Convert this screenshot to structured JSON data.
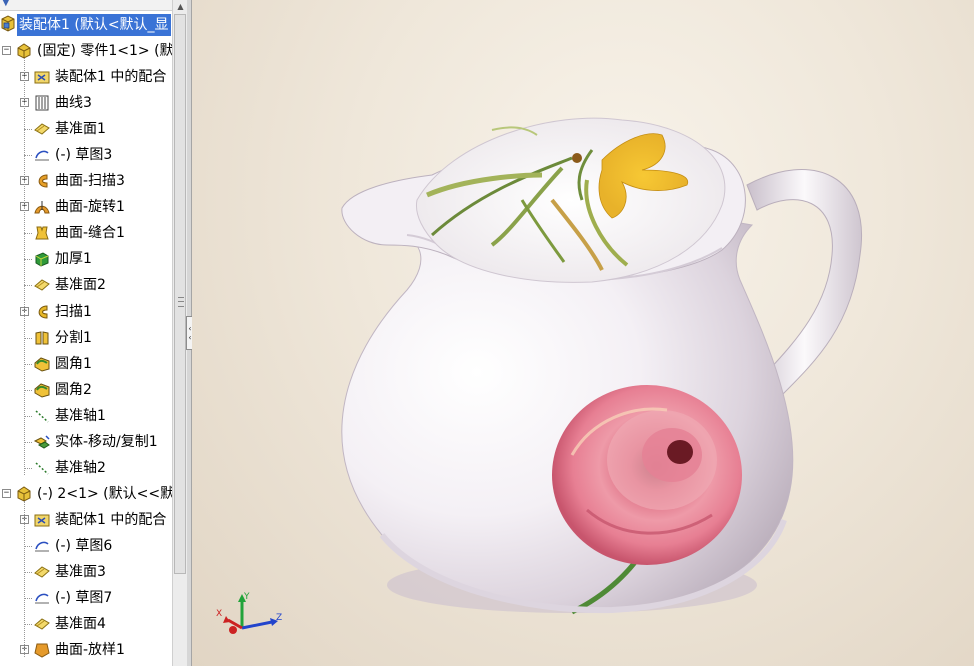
{
  "tree": {
    "root_label": "装配体1 (默认<默认_显",
    "rows": [
      {
        "label": "(固定) 零件1<1> (默",
        "icon": "part-icon",
        "level": 0,
        "expander": "−"
      },
      {
        "label": "装配体1 中的配合",
        "icon": "mates-folder-icon",
        "level": 1,
        "expander": "+"
      },
      {
        "label": "曲线3",
        "icon": "curve-icon",
        "level": 1,
        "expander": "+"
      },
      {
        "label": "基准面1",
        "icon": "plane-icon",
        "level": 1,
        "expander": ""
      },
      {
        "label": "(-) 草图3",
        "icon": "sketch-icon",
        "level": 1,
        "expander": ""
      },
      {
        "label": "曲面-扫描3",
        "icon": "surface-sweep-icon",
        "level": 1,
        "expander": "+"
      },
      {
        "label": "曲面-旋转1",
        "icon": "surface-revolve-icon",
        "level": 1,
        "expander": "+"
      },
      {
        "label": "曲面-缝合1",
        "icon": "surface-knit-icon",
        "level": 1,
        "expander": ""
      },
      {
        "label": "加厚1",
        "icon": "thicken-icon",
        "level": 1,
        "expander": ""
      },
      {
        "label": "基准面2",
        "icon": "plane-icon",
        "level": 1,
        "expander": ""
      },
      {
        "label": "扫描1",
        "icon": "sweep-icon",
        "level": 1,
        "expander": "+"
      },
      {
        "label": "分割1",
        "icon": "split-icon",
        "level": 1,
        "expander": ""
      },
      {
        "label": "圆角1",
        "icon": "fillet-icon",
        "level": 1,
        "expander": ""
      },
      {
        "label": "圆角2",
        "icon": "fillet-icon",
        "level": 1,
        "expander": ""
      },
      {
        "label": "基准轴1",
        "icon": "axis-icon",
        "level": 1,
        "expander": ""
      },
      {
        "label": "实体-移动/复制1",
        "icon": "move-copy-body-icon",
        "level": 1,
        "expander": ""
      },
      {
        "label": "基准轴2",
        "icon": "axis-icon",
        "level": 1,
        "expander": ""
      },
      {
        "label": "(-) 2<1> (默认<<默",
        "icon": "part-icon",
        "level": 0,
        "expander": "−"
      },
      {
        "label": "装配体1 中的配合",
        "icon": "mates-folder-icon",
        "level": 1,
        "expander": "+"
      },
      {
        "label": "(-) 草图6",
        "icon": "sketch-icon",
        "level": 1,
        "expander": ""
      },
      {
        "label": "基准面3",
        "icon": "plane-icon",
        "level": 1,
        "expander": ""
      },
      {
        "label": "(-) 草图7",
        "icon": "sketch-icon",
        "level": 1,
        "expander": ""
      },
      {
        "label": "基准面4",
        "icon": "plane-icon",
        "level": 1,
        "expander": ""
      },
      {
        "label": "曲面-放样1",
        "icon": "surface-loft-icon",
        "level": 1,
        "expander": "+"
      }
    ]
  },
  "triad": {
    "x_label": "X",
    "y_label": "Y",
    "z_label": "Z"
  },
  "colors": {
    "selection": "#3a73d6",
    "viewport_bg": "#efe7da",
    "triad_x": "#cc2222",
    "triad_y": "#22a33a",
    "triad_z": "#2244cc"
  }
}
